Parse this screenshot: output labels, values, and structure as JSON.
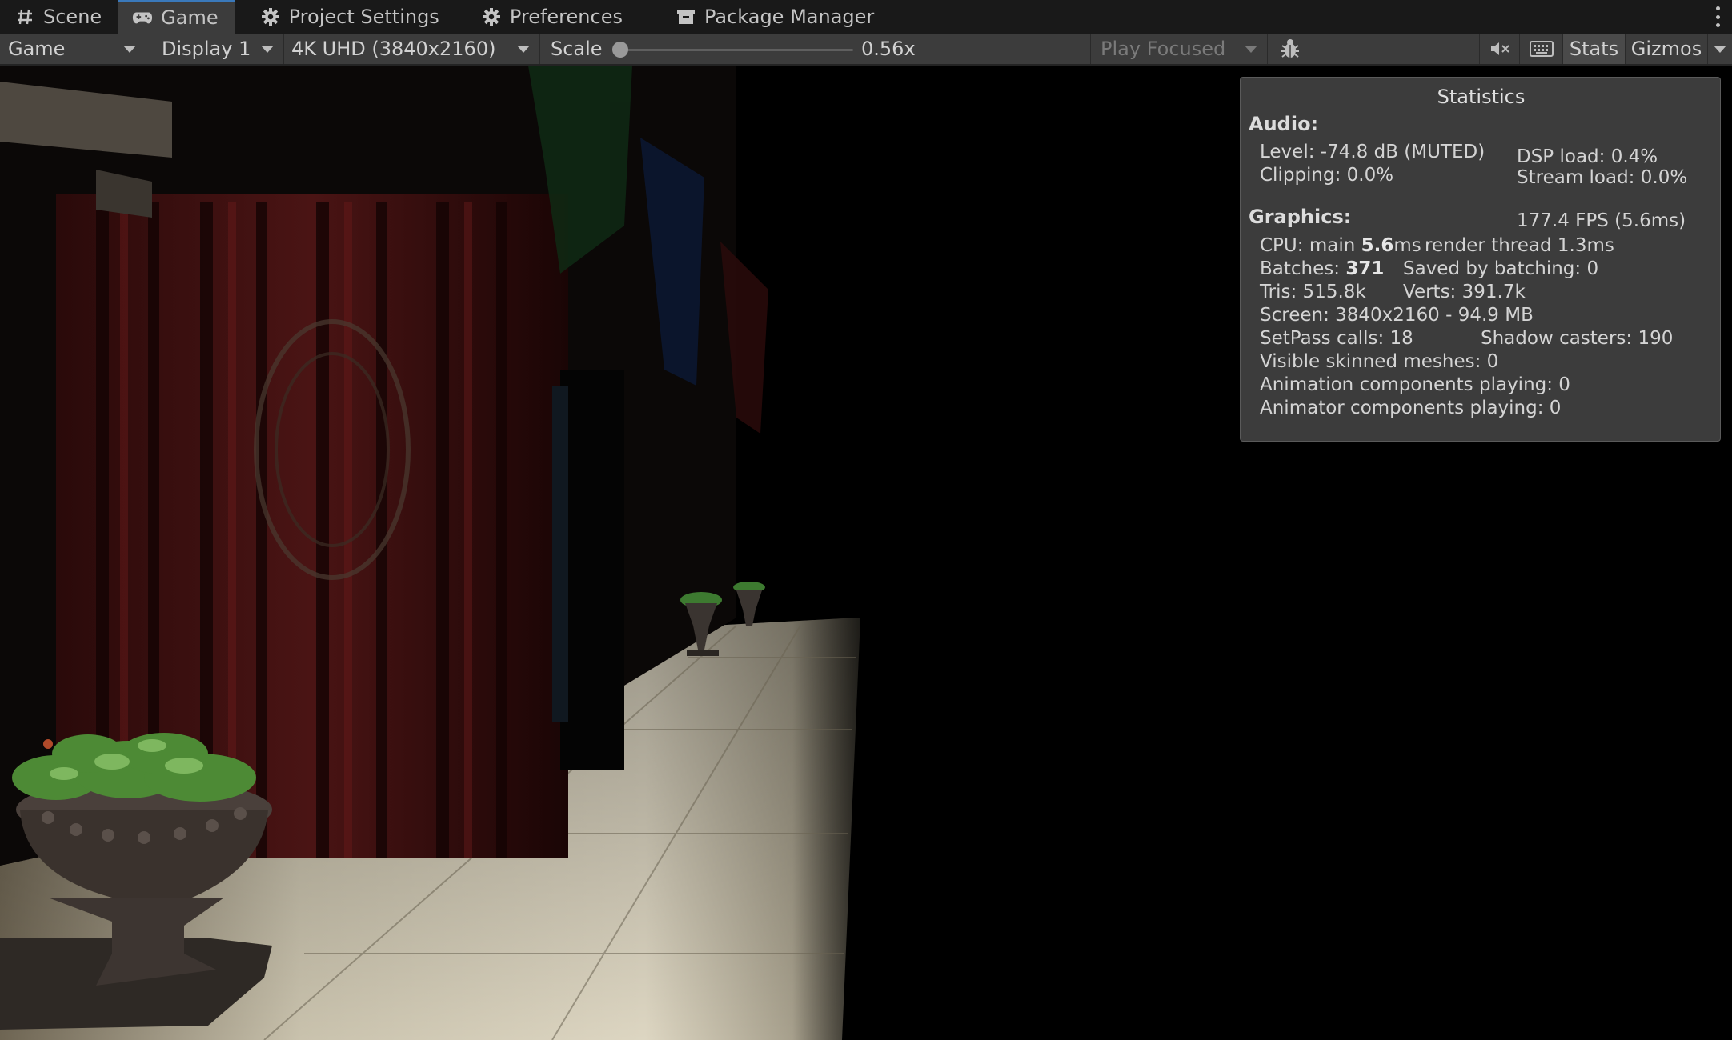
{
  "tabs": [
    {
      "label": "Scene",
      "icon": "scene-grid-icon"
    },
    {
      "label": "Game",
      "icon": "gamepad-icon"
    },
    {
      "label": "Project Settings",
      "icon": "gear-icon"
    },
    {
      "label": "Preferences",
      "icon": "gear-icon"
    },
    {
      "label": "Package Manager",
      "icon": "package-icon"
    }
  ],
  "toolbar": {
    "view_mode": "Game",
    "display": "Display 1",
    "resolution": "4K UHD (3840x2160)",
    "scale_label": "Scale",
    "scale_value": "0.56x",
    "scale_slider_fraction": 0.0,
    "play_mode": "Play Focused",
    "stats_label": "Stats",
    "gizmos_label": "Gizmos",
    "icons": [
      "bug-icon",
      "mute-audio-icon",
      "keyboard-icon"
    ]
  },
  "stats": {
    "title": "Statistics",
    "audio_header": "Audio:",
    "level": "Level: -74.8 dB (MUTED)",
    "clipping": "Clipping: 0.0%",
    "dsp_load": "DSP load: 0.4%",
    "stream_load": "Stream load: 0.0%",
    "graphics_header": "Graphics:",
    "fps": "177.4 FPS (5.6ms)",
    "cpu_prefix": "CPU: main ",
    "cpu_main": "5.6",
    "cpu_suffix": "ms",
    "render_thread": "render thread 1.3ms",
    "batches_prefix": "Batches: ",
    "batches": "371",
    "saved_by_batching": "Saved by batching: 0",
    "tris": "Tris: 515.8k",
    "verts": "Verts: 391.7k",
    "screen": "Screen: 3840x2160 - 94.9 MB",
    "setpass": "SetPass calls: 18",
    "shadow_casters": "Shadow casters: 190",
    "skinned": "Visible skinned meshes: 0",
    "animation": "Animation components playing: 0",
    "animator": "Animator components playing: 0"
  },
  "colors": {
    "tab_active_accent": "#3a79bb",
    "toolbar_bg": "#3c3c3c",
    "panel_bg": "#3e3e3e"
  }
}
